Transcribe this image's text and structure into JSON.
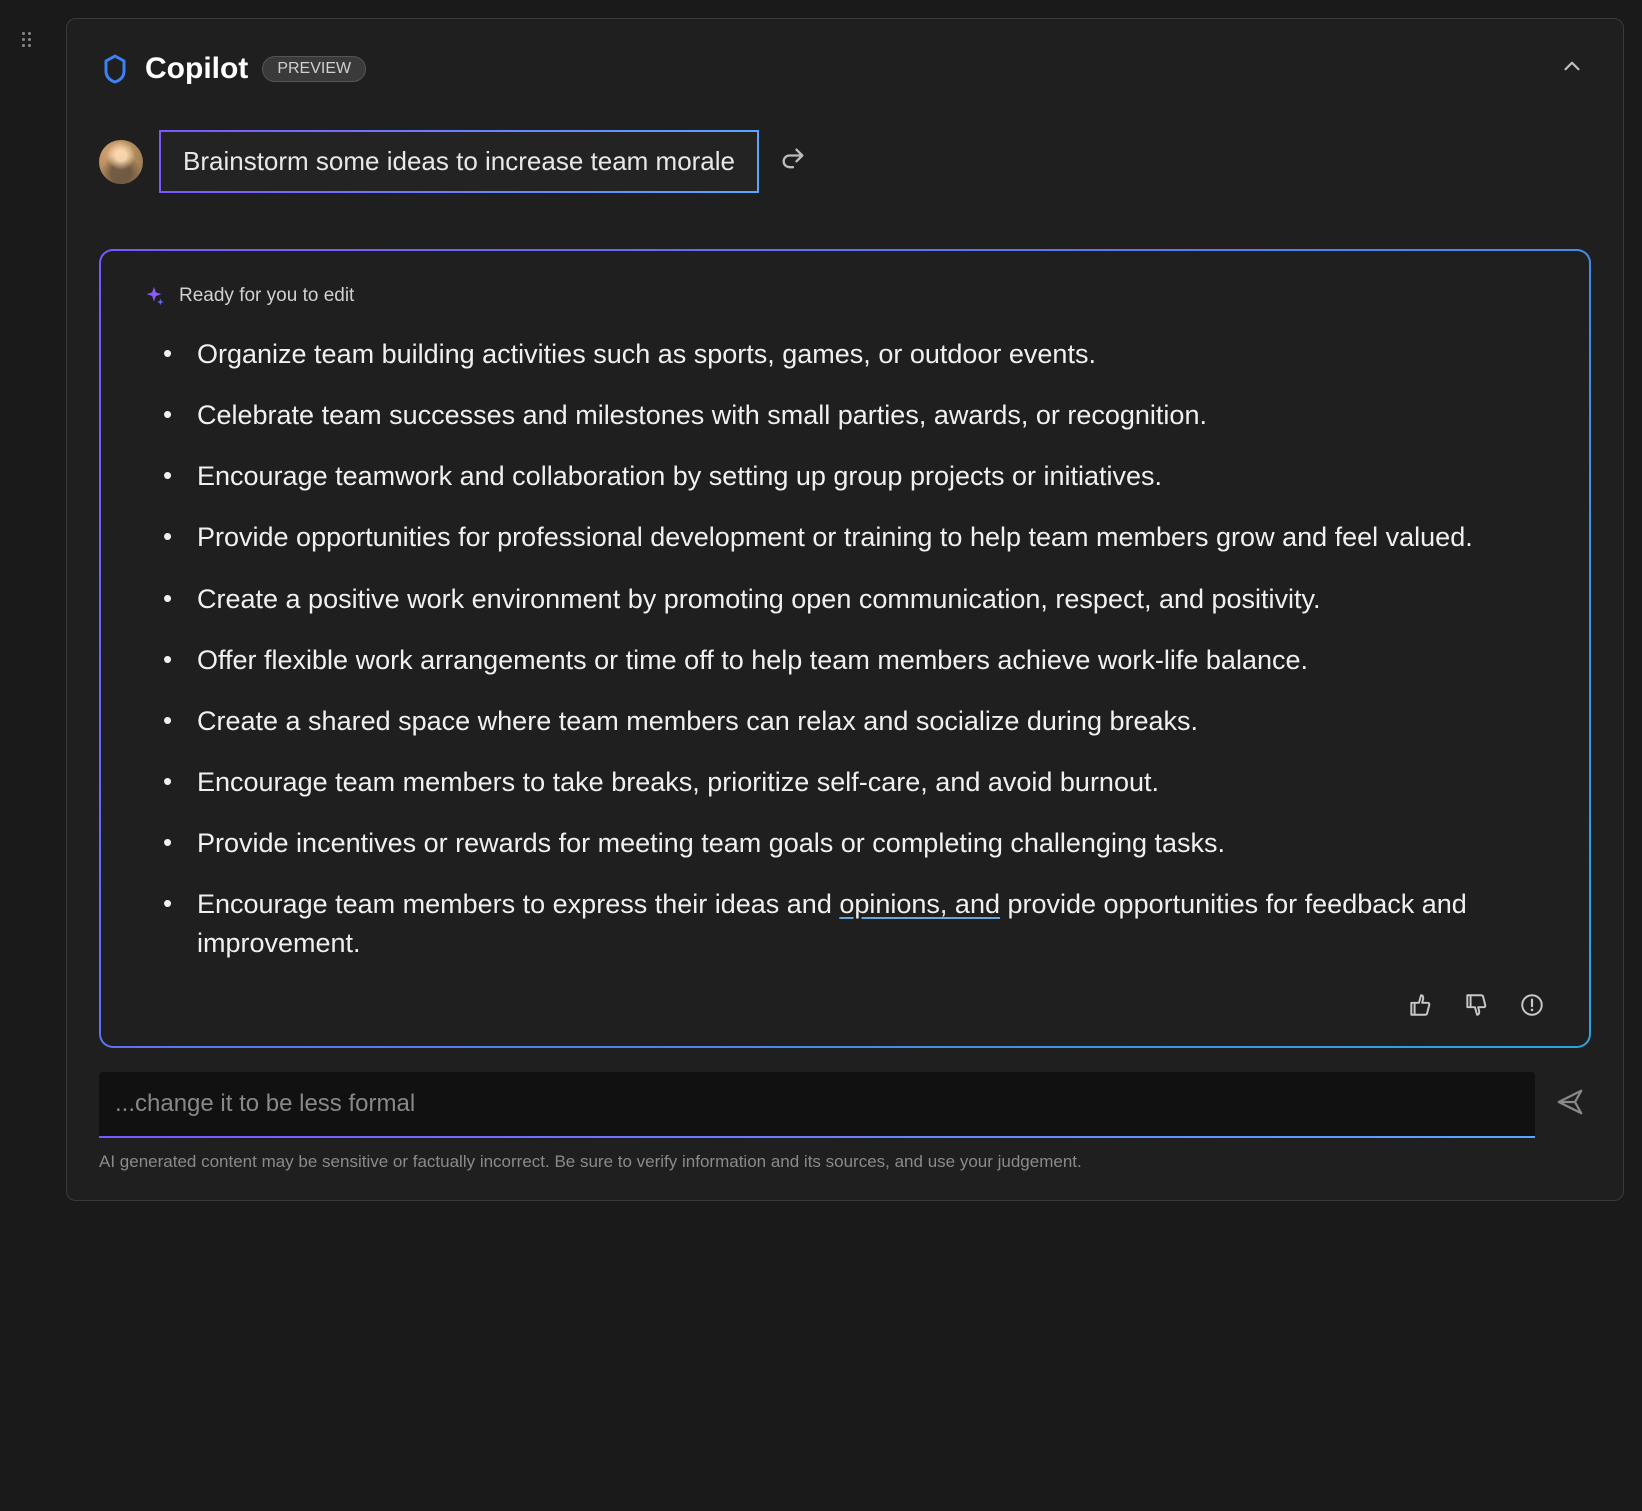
{
  "header": {
    "title": "Copilot",
    "badge": "PREVIEW"
  },
  "prompt": {
    "text": "Brainstorm some ideas to increase team morale"
  },
  "response": {
    "ready_label": "Ready for you to edit",
    "items": [
      "Organize team building activities such as sports, games, or outdoor events.",
      "Celebrate team successes and milestones with small parties, awards, or recognition.",
      "Encourage teamwork and collaboration by setting up group projects or initiatives.",
      "Provide opportunities for professional development or training to help team members grow and feel valued.",
      "Create a positive work environment by promoting open communication, respect, and positivity.",
      "Offer flexible work arrangements or time off to help team members achieve work-life balance.",
      "Create a shared space where team members can relax and socialize during breaks.",
      "Encourage team members to take breaks, prioritize self-care, and avoid burnout.",
      "Provide incentives or rewards for meeting team goals or completing challenging tasks."
    ],
    "last_item_pre": "Encourage team members to express their ideas and ",
    "last_item_underlined": "opinions, and",
    "last_item_post": " provide opportunities for feedback and improvement."
  },
  "input": {
    "placeholder": "...change it to be less formal"
  },
  "disclaimer": "AI generated content may be sensitive or factually incorrect. Be sure to verify information and its sources, and use your judgement."
}
